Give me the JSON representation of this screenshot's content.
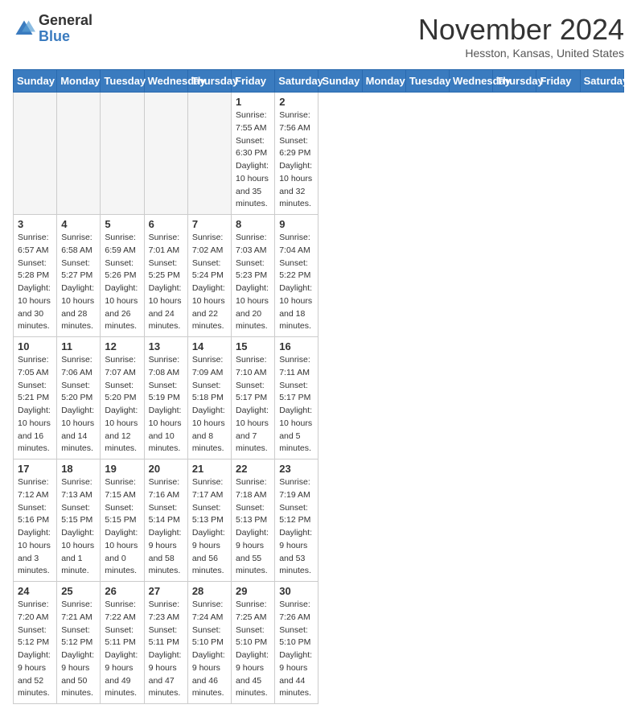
{
  "header": {
    "logo_general": "General",
    "logo_blue": "Blue",
    "month_title": "November 2024",
    "location": "Hesston, Kansas, United States"
  },
  "days_of_week": [
    "Sunday",
    "Monday",
    "Tuesday",
    "Wednesday",
    "Thursday",
    "Friday",
    "Saturday"
  ],
  "weeks": [
    [
      {
        "day": "",
        "info": ""
      },
      {
        "day": "",
        "info": ""
      },
      {
        "day": "",
        "info": ""
      },
      {
        "day": "",
        "info": ""
      },
      {
        "day": "",
        "info": ""
      },
      {
        "day": "1",
        "info": "Sunrise: 7:55 AM\nSunset: 6:30 PM\nDaylight: 10 hours\nand 35 minutes."
      },
      {
        "day": "2",
        "info": "Sunrise: 7:56 AM\nSunset: 6:29 PM\nDaylight: 10 hours\nand 32 minutes."
      }
    ],
    [
      {
        "day": "3",
        "info": "Sunrise: 6:57 AM\nSunset: 5:28 PM\nDaylight: 10 hours\nand 30 minutes."
      },
      {
        "day": "4",
        "info": "Sunrise: 6:58 AM\nSunset: 5:27 PM\nDaylight: 10 hours\nand 28 minutes."
      },
      {
        "day": "5",
        "info": "Sunrise: 6:59 AM\nSunset: 5:26 PM\nDaylight: 10 hours\nand 26 minutes."
      },
      {
        "day": "6",
        "info": "Sunrise: 7:01 AM\nSunset: 5:25 PM\nDaylight: 10 hours\nand 24 minutes."
      },
      {
        "day": "7",
        "info": "Sunrise: 7:02 AM\nSunset: 5:24 PM\nDaylight: 10 hours\nand 22 minutes."
      },
      {
        "day": "8",
        "info": "Sunrise: 7:03 AM\nSunset: 5:23 PM\nDaylight: 10 hours\nand 20 minutes."
      },
      {
        "day": "9",
        "info": "Sunrise: 7:04 AM\nSunset: 5:22 PM\nDaylight: 10 hours\nand 18 minutes."
      }
    ],
    [
      {
        "day": "10",
        "info": "Sunrise: 7:05 AM\nSunset: 5:21 PM\nDaylight: 10 hours\nand 16 minutes."
      },
      {
        "day": "11",
        "info": "Sunrise: 7:06 AM\nSunset: 5:20 PM\nDaylight: 10 hours\nand 14 minutes."
      },
      {
        "day": "12",
        "info": "Sunrise: 7:07 AM\nSunset: 5:20 PM\nDaylight: 10 hours\nand 12 minutes."
      },
      {
        "day": "13",
        "info": "Sunrise: 7:08 AM\nSunset: 5:19 PM\nDaylight: 10 hours\nand 10 minutes."
      },
      {
        "day": "14",
        "info": "Sunrise: 7:09 AM\nSunset: 5:18 PM\nDaylight: 10 hours\nand 8 minutes."
      },
      {
        "day": "15",
        "info": "Sunrise: 7:10 AM\nSunset: 5:17 PM\nDaylight: 10 hours\nand 7 minutes."
      },
      {
        "day": "16",
        "info": "Sunrise: 7:11 AM\nSunset: 5:17 PM\nDaylight: 10 hours\nand 5 minutes."
      }
    ],
    [
      {
        "day": "17",
        "info": "Sunrise: 7:12 AM\nSunset: 5:16 PM\nDaylight: 10 hours\nand 3 minutes."
      },
      {
        "day": "18",
        "info": "Sunrise: 7:13 AM\nSunset: 5:15 PM\nDaylight: 10 hours\nand 1 minute."
      },
      {
        "day": "19",
        "info": "Sunrise: 7:15 AM\nSunset: 5:15 PM\nDaylight: 10 hours\nand 0 minutes."
      },
      {
        "day": "20",
        "info": "Sunrise: 7:16 AM\nSunset: 5:14 PM\nDaylight: 9 hours\nand 58 minutes."
      },
      {
        "day": "21",
        "info": "Sunrise: 7:17 AM\nSunset: 5:13 PM\nDaylight: 9 hours\nand 56 minutes."
      },
      {
        "day": "22",
        "info": "Sunrise: 7:18 AM\nSunset: 5:13 PM\nDaylight: 9 hours\nand 55 minutes."
      },
      {
        "day": "23",
        "info": "Sunrise: 7:19 AM\nSunset: 5:12 PM\nDaylight: 9 hours\nand 53 minutes."
      }
    ],
    [
      {
        "day": "24",
        "info": "Sunrise: 7:20 AM\nSunset: 5:12 PM\nDaylight: 9 hours\nand 52 minutes."
      },
      {
        "day": "25",
        "info": "Sunrise: 7:21 AM\nSunset: 5:12 PM\nDaylight: 9 hours\nand 50 minutes."
      },
      {
        "day": "26",
        "info": "Sunrise: 7:22 AM\nSunset: 5:11 PM\nDaylight: 9 hours\nand 49 minutes."
      },
      {
        "day": "27",
        "info": "Sunrise: 7:23 AM\nSunset: 5:11 PM\nDaylight: 9 hours\nand 47 minutes."
      },
      {
        "day": "28",
        "info": "Sunrise: 7:24 AM\nSunset: 5:10 PM\nDaylight: 9 hours\nand 46 minutes."
      },
      {
        "day": "29",
        "info": "Sunrise: 7:25 AM\nSunset: 5:10 PM\nDaylight: 9 hours\nand 45 minutes."
      },
      {
        "day": "30",
        "info": "Sunrise: 7:26 AM\nSunset: 5:10 PM\nDaylight: 9 hours\nand 44 minutes."
      }
    ]
  ]
}
